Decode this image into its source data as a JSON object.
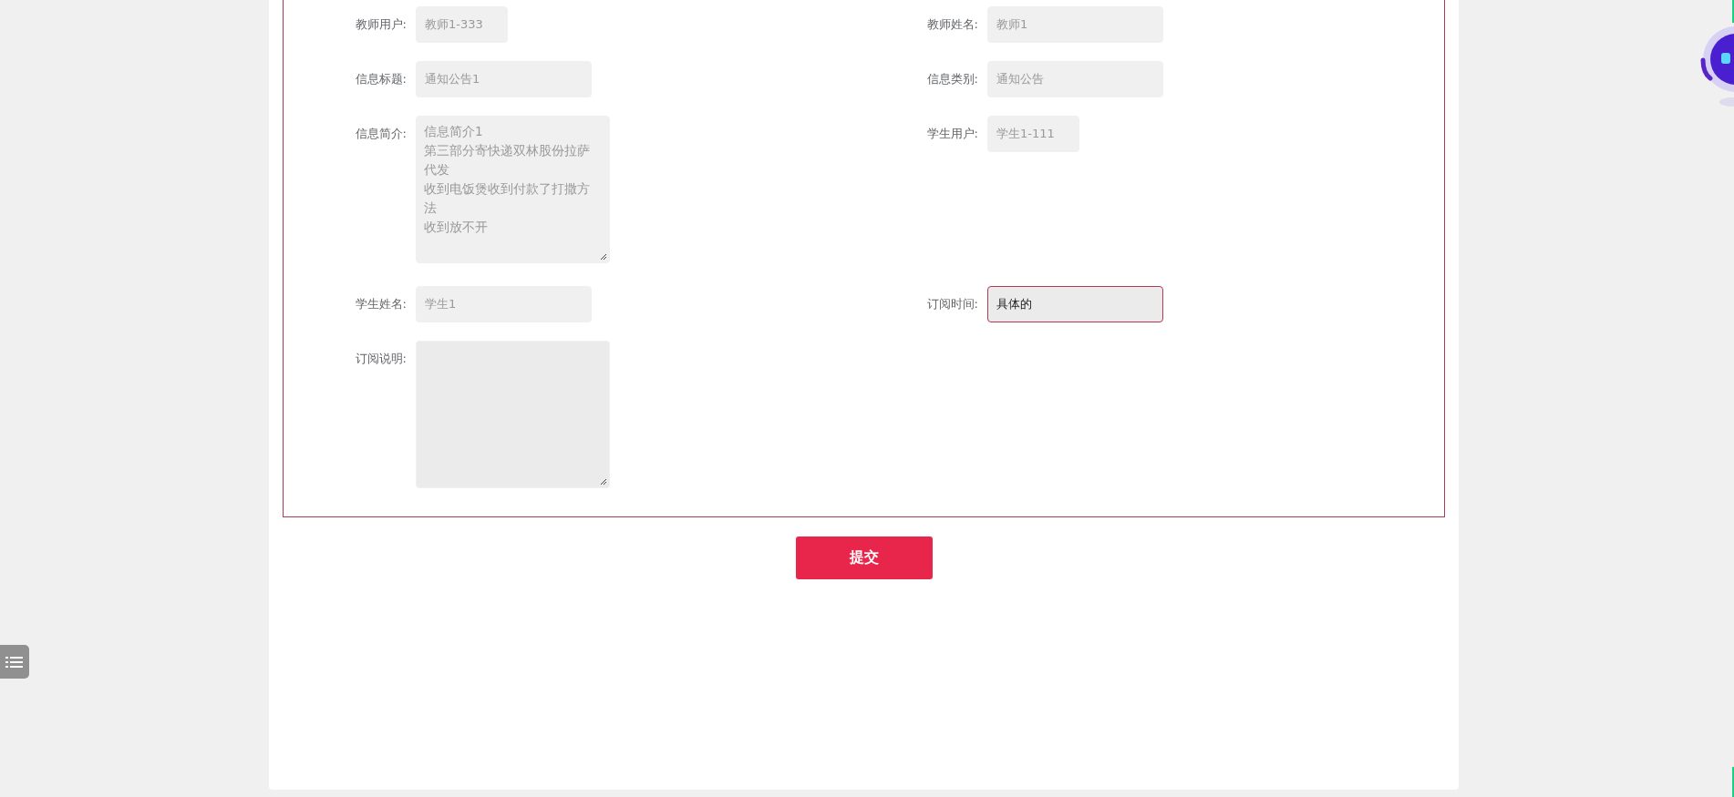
{
  "form": {
    "rows": [
      {
        "left": {
          "label": "教师用户:",
          "value": "教师1-333",
          "kind": "short",
          "disabled": true,
          "focused": false
        },
        "right": {
          "label": "教师姓名:",
          "value": "教师1",
          "kind": "input",
          "disabled": true,
          "focused": false
        }
      },
      {
        "left": {
          "label": "信息标题:",
          "value": "通知公告1",
          "kind": "input",
          "disabled": true,
          "focused": false
        },
        "right": {
          "label": "信息类别:",
          "value": "通知公告",
          "kind": "input",
          "disabled": true,
          "focused": false
        }
      },
      {
        "left": {
          "label": "信息简介:",
          "lines": [
            "信息简介1",
            "第三部分寄快递双林股份拉萨代发",
            "收到电饭煲收到付款了打撒方法",
            "收到放不开"
          ],
          "kind": "textarea",
          "disabled": true,
          "focused": false
        },
        "right": {
          "label": "学生用户:",
          "value": "学生1-111",
          "kind": "short",
          "disabled": true,
          "focused": false
        }
      },
      {
        "left": {
          "label": "学生姓名:",
          "value": "学生1",
          "kind": "input",
          "disabled": true,
          "focused": false
        },
        "right": {
          "label": "订阅时间:",
          "value": "具体的",
          "kind": "input",
          "disabled": false,
          "focused": true
        }
      },
      {
        "left": {
          "label": "订阅说明:",
          "kind": "textarea",
          "focused": false
        }
      }
    ]
  },
  "submit_button": "提交"
}
